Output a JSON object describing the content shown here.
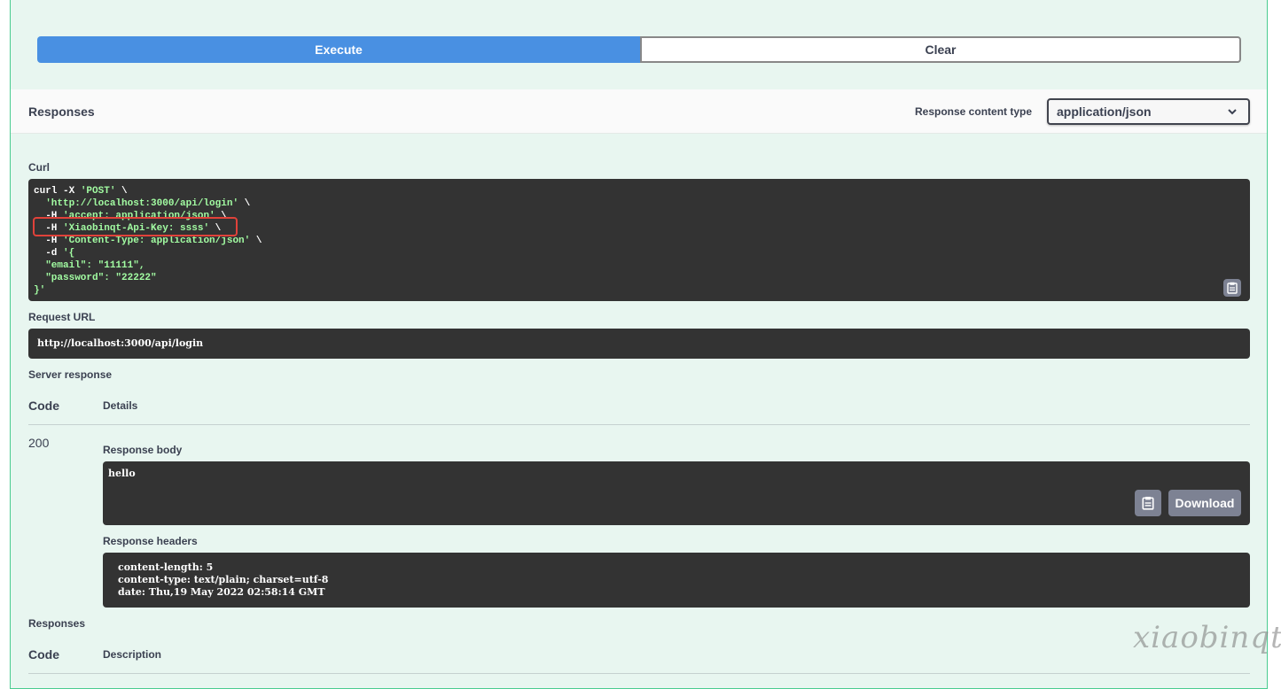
{
  "buttons": {
    "execute": "Execute",
    "clear": "Clear"
  },
  "responses_header": {
    "title": "Responses",
    "content_type_label": "Response content type",
    "content_type_value": "application/json"
  },
  "curl": {
    "label": "Curl",
    "lines": [
      [
        {
          "t": "curl -X ",
          "s": false
        },
        {
          "t": "'POST'",
          "s": true
        },
        {
          "t": " \\",
          "s": false
        }
      ],
      [
        {
          "t": "  ",
          "s": false
        },
        {
          "t": "'http://localhost:3000/api/login'",
          "s": true
        },
        {
          "t": " \\",
          "s": false
        }
      ],
      [
        {
          "t": "  -H ",
          "s": false
        },
        {
          "t": "'accept: application/json'",
          "s": true
        },
        {
          "t": " \\",
          "s": false
        }
      ],
      [
        {
          "t": "  -H ",
          "s": false
        },
        {
          "t": "'Xiaobinqt-Api-Key: ssss'",
          "s": true
        },
        {
          "t": " \\",
          "s": false
        }
      ],
      [
        {
          "t": "  -H ",
          "s": false
        },
        {
          "t": "'Content-Type: application/json'",
          "s": true
        },
        {
          "t": " \\",
          "s": false
        }
      ],
      [
        {
          "t": "  -d ",
          "s": false
        },
        {
          "t": "'{",
          "s": true
        }
      ],
      [
        {
          "t": "  \"email\": \"11111\",",
          "s": true
        }
      ],
      [
        {
          "t": "  \"password\": \"22222\"",
          "s": true
        }
      ],
      [
        {
          "t": "}'",
          "s": true
        }
      ]
    ]
  },
  "request_url": {
    "label": "Request URL",
    "value": "http://localhost:3000/api/login"
  },
  "server_response": {
    "label": "Server response",
    "col_code": "Code",
    "col_details": "Details",
    "code": "200",
    "body_label": "Response body",
    "body": "hello",
    "download_label": "Download",
    "headers_label": "Response headers",
    "headers": [
      "content-length: 5",
      "content-type: text/plain; charset=utf-8",
      "date: Thu,19 May 2022 02:58:14 GMT"
    ]
  },
  "responses_section": {
    "label": "Responses",
    "col_code": "Code",
    "col_description": "Description"
  },
  "watermark": "xiaobinqt",
  "colors": {
    "execute": "#4990e2",
    "opblock_bg": "#e8f6f0",
    "opblock_border": "#49cc90",
    "code_bg": "#333333",
    "string": "#a2fca2",
    "highlight": "#e0423a"
  }
}
